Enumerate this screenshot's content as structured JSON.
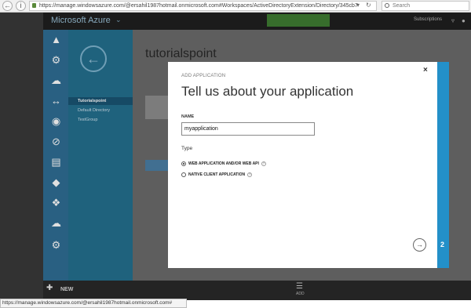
{
  "browser": {
    "url": "https://manage.windowsazure.com/@ersahil1987hotmail.onmicrosoft.com#Workspaces/ActiveDirectoryExtension/Directory/345cb7",
    "search_placeholder": "Search"
  },
  "portal": {
    "brand": "Microsoft Azure",
    "subscriptions_label": "Subscriptions",
    "directory_title": "tutorialspoint",
    "sub_nav": [
      "Tutorialspoint",
      "Default Directory",
      "TestGroup"
    ],
    "new_label": "NEW",
    "add_label": "ADD"
  },
  "modal": {
    "small_title": "ADD APPLICATION",
    "heading": "Tell us about your application",
    "name_label": "NAME",
    "name_value": "myapplication",
    "type_label": "Type",
    "options": [
      {
        "label": "WEB APPLICATION AND/OR WEB API",
        "selected": true
      },
      {
        "label": "NATIVE CLIENT APPLICATION",
        "selected": false
      }
    ],
    "step_number": "2"
  },
  "status_bar": {
    "text": "https://manage.windowsazure.com/@ersahil1987hotmail.onmicrosoft.com#"
  }
}
